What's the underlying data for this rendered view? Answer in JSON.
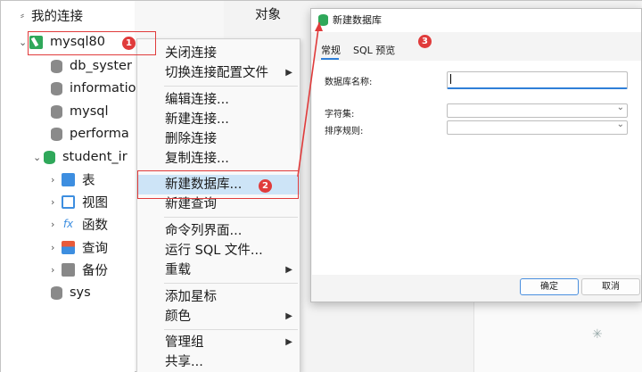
{
  "navigator": {
    "header": "我的连接",
    "connection": "mysql80",
    "databases": [
      "db_syster",
      "informatio",
      "mysql",
      "performa"
    ],
    "open_database": "student_ir",
    "children": [
      "表",
      "视图",
      "函数",
      "查询",
      "备份"
    ],
    "sys": "sys"
  },
  "main": {
    "title": "对象"
  },
  "context_menu": {
    "items": [
      "关闭连接",
      "切换连接配置文件",
      "编辑连接...",
      "新建连接...",
      "删除连接",
      "复制连接...",
      "新建数据库...",
      "新建查询",
      "命令列界面...",
      "运行 SQL 文件...",
      "重载",
      "添加星标",
      "颜色",
      "管理组",
      "共享..."
    ],
    "highlighted": "新建数据库..."
  },
  "dialog": {
    "title": "新建数据库",
    "tabs": [
      "常规",
      "SQL 预览"
    ],
    "labels": {
      "name": "数据库名称:",
      "charset": "字符集:",
      "collation": "排序规则:"
    },
    "name_value": "",
    "charset_value": "",
    "collation_value": "",
    "ok": "确定",
    "cancel": "取消"
  },
  "annotations": [
    "1",
    "2",
    "3"
  ],
  "colors": {
    "annotation": "#e03b3b",
    "accent": "#2f7fd8",
    "db_green": "#2fa85a",
    "highlight": "#cde4f7"
  }
}
